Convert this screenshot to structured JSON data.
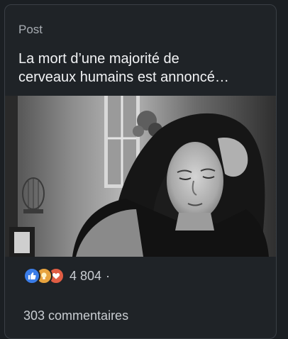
{
  "post": {
    "kind_label": "Post",
    "title": "La mort d’une majorité de\ncerveaux humains est annoncé…",
    "image_alt": "Femme pensive, tête appuyée sur la main (photo noir et blanc)"
  },
  "social": {
    "reaction_icons": [
      "like-icon",
      "idea-icon",
      "love-icon"
    ],
    "reaction_count": "4 804",
    "separator": "·",
    "comments_label": "303 commentaires"
  },
  "colors": {
    "background": "#1b1f23",
    "card": "#1f2327",
    "like": "#3b7de8",
    "idea": "#e7a33e",
    "love": "#e05d44"
  }
}
